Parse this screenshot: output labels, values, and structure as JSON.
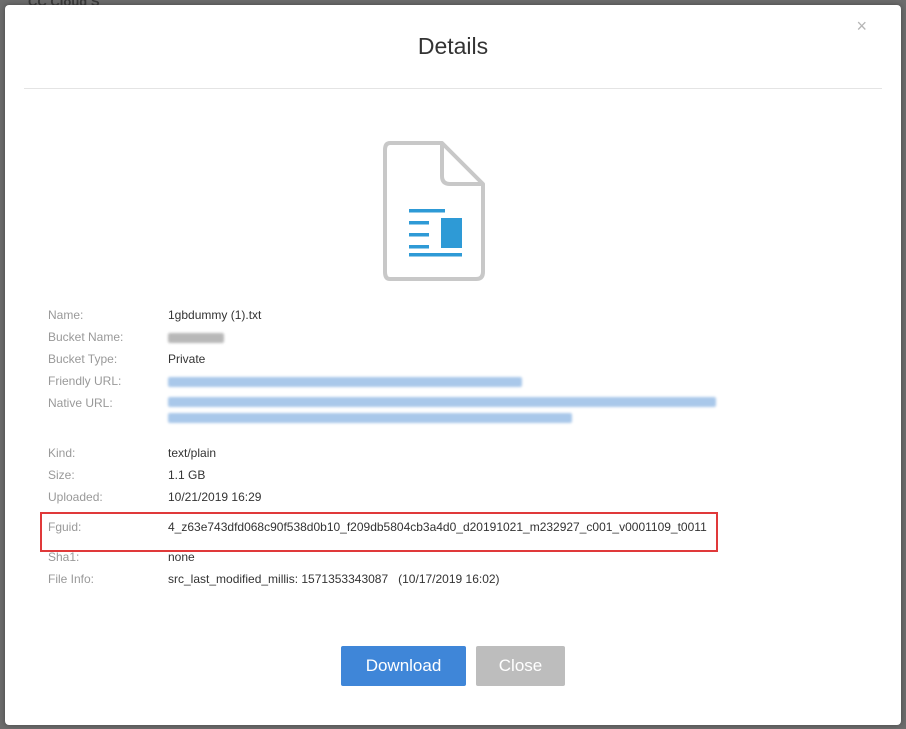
{
  "backdrop": {
    "text": "CC Cloud S"
  },
  "modal": {
    "title": "Details",
    "close_glyph": "×"
  },
  "icon": {
    "name": "file-document-icon",
    "stroke_color": "#c8c8c8",
    "accent_color": "#2e9ad6"
  },
  "details": {
    "name_label": "Name:",
    "name_value": "1gbdummy (1).txt",
    "bucket_name_label": "Bucket Name:",
    "bucket_type_label": "Bucket Type:",
    "bucket_type_value": "Private",
    "friendly_url_label": "Friendly URL:",
    "native_url_label": "Native URL:",
    "kind_label": "Kind:",
    "kind_value": "text/plain",
    "size_label": "Size:",
    "size_value": "1.1 GB",
    "uploaded_label": "Uploaded:",
    "uploaded_value": "10/21/2019 16:29",
    "fguid_label": "Fguid:",
    "fguid_value": "4_z63e743dfd068c90f538d0b10_f209db5804cb3a4d0_d20191021_m232927_c001_v0001109_t0011",
    "sha1_label": "Sha1:",
    "sha1_value": "none",
    "file_info_label": "File Info:",
    "file_info_value": "src_last_modified_millis: 1571353343087   (10/17/2019 16:02)"
  },
  "buttons": {
    "download_label": "Download",
    "close_label": "Close"
  },
  "colors": {
    "primary": "#3f86d8",
    "disabled": "#bdbdbd",
    "highlight": "#e0393a"
  }
}
